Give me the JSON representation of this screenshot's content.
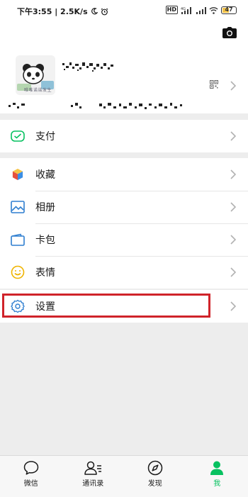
{
  "status_bar": {
    "time_speed": "下午3:55 | 2.5K/s",
    "hd": "HD",
    "network": "4G",
    "battery": "47"
  },
  "profile": {
    "avatar_caption": "唯唯诺诺发生"
  },
  "menu": {
    "pay": {
      "label": "支付",
      "icon": "wechat-pay-icon",
      "color": "#07c160"
    },
    "favorites": {
      "label": "收藏",
      "icon": "cube-icon"
    },
    "album": {
      "label": "相册",
      "icon": "image-icon",
      "color": "#2f7fd0"
    },
    "cards": {
      "label": "卡包",
      "icon": "wallet-icon",
      "color": "#2f7fd0"
    },
    "stickers": {
      "label": "表情",
      "icon": "smiley-icon",
      "color": "#f0b400"
    },
    "settings": {
      "label": "设置",
      "icon": "gear-icon",
      "color": "#2f7fd0"
    }
  },
  "highlight_color": "#d0232a",
  "tabbar": {
    "tabs": [
      {
        "label": "微信",
        "icon": "chat-bubble-icon"
      },
      {
        "label": "通讯录",
        "icon": "contacts-icon"
      },
      {
        "label": "发现",
        "icon": "compass-icon"
      },
      {
        "label": "我",
        "icon": "person-icon",
        "active": true
      }
    ],
    "active_color": "#07c160"
  }
}
